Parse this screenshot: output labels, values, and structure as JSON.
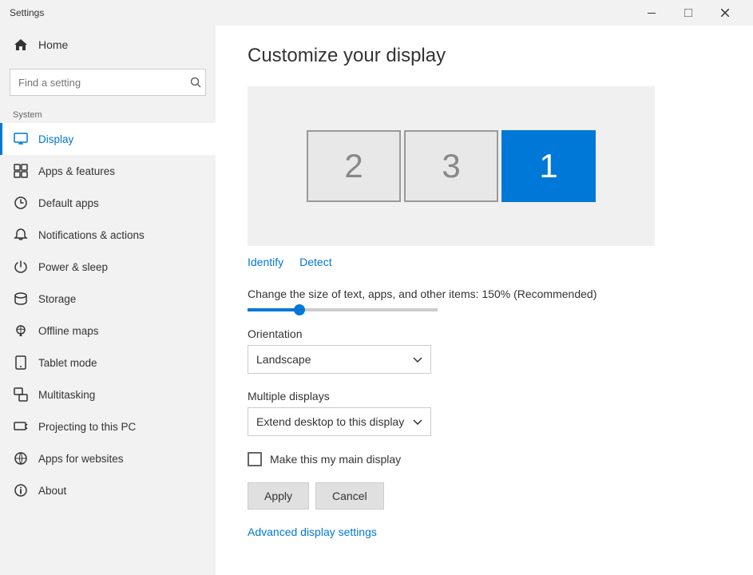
{
  "titleBar": {
    "title": "Settings"
  },
  "sidebar": {
    "homeLabel": "Home",
    "searchPlaceholder": "Find a setting",
    "sectionLabel": "System",
    "items": [
      {
        "id": "display",
        "label": "Display",
        "active": true
      },
      {
        "id": "apps-features",
        "label": "Apps & features",
        "active": false
      },
      {
        "id": "default-apps",
        "label": "Default apps",
        "active": false
      },
      {
        "id": "notifications",
        "label": "Notifications & actions",
        "active": false
      },
      {
        "id": "power-sleep",
        "label": "Power & sleep",
        "active": false
      },
      {
        "id": "storage",
        "label": "Storage",
        "active": false
      },
      {
        "id": "offline-maps",
        "label": "Offline maps",
        "active": false
      },
      {
        "id": "tablet-mode",
        "label": "Tablet mode",
        "active": false
      },
      {
        "id": "multitasking",
        "label": "Multitasking",
        "active": false
      },
      {
        "id": "projecting",
        "label": "Projecting to this PC",
        "active": false
      },
      {
        "id": "apps-websites",
        "label": "Apps for websites",
        "active": false
      },
      {
        "id": "about",
        "label": "About",
        "active": false
      }
    ]
  },
  "main": {
    "pageTitle": "Customize your display",
    "monitors": [
      {
        "number": "2",
        "active": false
      },
      {
        "number": "3",
        "active": false
      },
      {
        "number": "1",
        "active": true
      }
    ],
    "identifyLabel": "Identify",
    "detectLabel": "Detect",
    "scaleLabel": "Change the size of text, apps, and other items: 150% (Recommended)",
    "orientationLabel": "Orientation",
    "orientationValue": "Landscape",
    "multipleDisplaysLabel": "Multiple displays",
    "multipleDisplaysValue": "Extend desktop to this display",
    "mainDisplayLabel": "Make this my main display",
    "applyLabel": "Apply",
    "cancelLabel": "Cancel",
    "advancedLabel": "Advanced display settings"
  }
}
